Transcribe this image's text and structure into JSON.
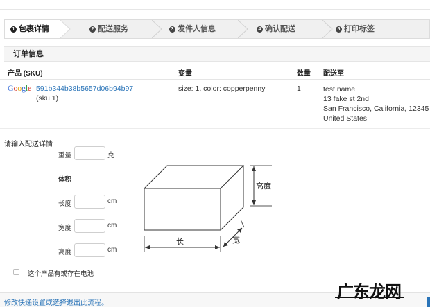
{
  "steps": [
    {
      "num": "1",
      "label": "包裹详情"
    },
    {
      "num": "2",
      "label": "配送服务"
    },
    {
      "num": "3",
      "label": "发件人信息"
    },
    {
      "num": "4",
      "label": "确认配送"
    },
    {
      "num": "5",
      "label": "打印标签"
    }
  ],
  "order": {
    "title": "订单信息",
    "columns": {
      "product": "产品 (SKU)",
      "variant": "变量",
      "qty": "数量",
      "ship_to": "配送至"
    },
    "row": {
      "logo": "Google",
      "sku": "591b344b38b5657d06b94b97",
      "sku_sub": "(sku 1)",
      "variant": "size: 1, color: copperpenny",
      "qty": "1",
      "address": [
        "test name",
        "13 fake st 2nd",
        "San Francisco, California, 12345",
        "United States"
      ]
    }
  },
  "details": {
    "title": "请输入配送详情",
    "weight_label": "重量",
    "weight_unit": "克",
    "volume_label": "体积",
    "length_label": "长度",
    "width_label": "宽度",
    "height_label": "高度",
    "unit_cm": "cm",
    "diagram_length": "长",
    "diagram_width": "宽",
    "diagram_height": "高度",
    "battery_label": "这个产品有或存在电池"
  },
  "footer": {
    "link": "修改快递设置或选择退出此流程。"
  },
  "watermark": {
    "text": "广东龙网"
  }
}
